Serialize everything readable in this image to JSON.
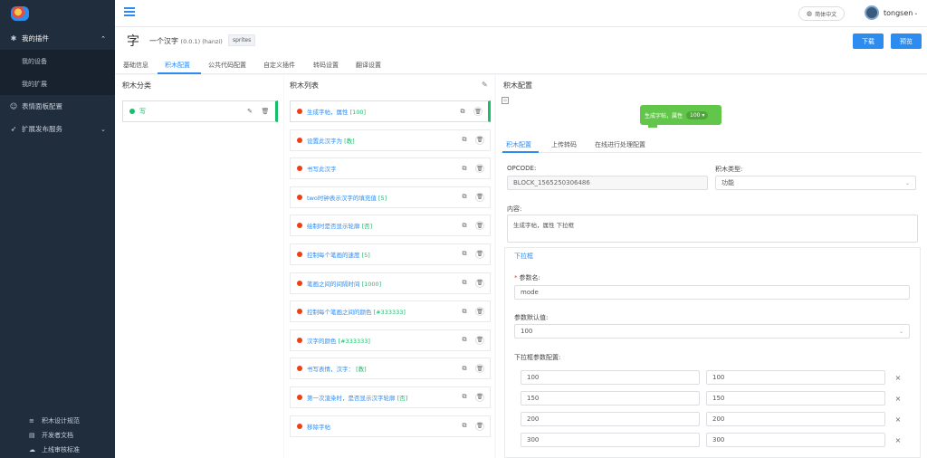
{
  "sidebar": {
    "items": [
      {
        "label": "我的插件",
        "icon": "pin-icon",
        "active": true
      },
      {
        "label": "我的设备",
        "sub": true
      },
      {
        "label": "我的扩展",
        "sub": true
      },
      {
        "label": "表情面板配置",
        "icon": "smile-icon"
      },
      {
        "label": "扩展发布服务",
        "icon": "send-icon"
      }
    ],
    "bottom": [
      {
        "label": "积木设计规范",
        "icon": "layers-icon"
      },
      {
        "label": "开发者文档",
        "icon": "doc-icon"
      },
      {
        "label": "上线审核标准",
        "icon": "cloud-icon"
      }
    ]
  },
  "header": {
    "lang": "简体中文",
    "user": "tongsen"
  },
  "extension": {
    "icon_char": "字",
    "name": "一个汉字",
    "version": "(0.0.1) (hanzi)",
    "tag": "sprites",
    "download": "下载",
    "preview": "预览"
  },
  "tabs": [
    "基础信息",
    "积木配置",
    "公共代码配置",
    "自定义插件",
    "转码设置",
    "翻译设置"
  ],
  "categories_panel": {
    "title": "积木分类",
    "items": [
      {
        "label": "写"
      }
    ]
  },
  "blocks_panel": {
    "title": "积木列表",
    "items": [
      {
        "text": "生成字帖，属性 ",
        "param": "[100]"
      },
      {
        "text": "设置此汉字为 ",
        "param": "[教]"
      },
      {
        "text": "书写此汉字",
        "param": ""
      },
      {
        "text": "two时钟表示汉字的填充值 ",
        "param": "[5]"
      },
      {
        "text": "绘制时是否显示轮廓 ",
        "param": "[否]"
      },
      {
        "text": "控制每个笔画的速度 ",
        "param": "[5]"
      },
      {
        "text": "笔画之间的间隔时间 ",
        "param": "[1000]"
      },
      {
        "text": "控制每个笔画之间的颜色 ",
        "param": "[#333333]"
      },
      {
        "text": "汉字的颜色 ",
        "param": "[#333333]"
      },
      {
        "text": "书写表情，汉字： ",
        "param": "[教]"
      },
      {
        "text": "第一次渲染时，是否显示汉字轮廓 ",
        "param": "[否]"
      },
      {
        "text": "移除字帖",
        "param": ""
      }
    ]
  },
  "config_panel": {
    "title": "积木配置",
    "preview_text": "生成字帖，属性",
    "preview_value": "100 ▾",
    "subtabs": [
      "积木配置",
      "上传转码",
      "在线进行处理配置"
    ],
    "opcode_label": "OPCODE:",
    "opcode_value": "BLOCK_1565250306486",
    "type_label": "积木类型:",
    "type_value": "功能",
    "content_label": "内容:",
    "content_value": "生成字帖，属性 下拉框",
    "dropdown_title": "下拉框",
    "param_name_label": "参数名:",
    "param_name_value": "mode",
    "default_label": "参数默认值:",
    "default_value": "100",
    "options_label": "下拉框参数配置:",
    "options": [
      {
        "key": "100",
        "value": "100"
      },
      {
        "key": "150",
        "value": "150"
      },
      {
        "key": "200",
        "value": "200"
      },
      {
        "key": "300",
        "value": "300"
      }
    ]
  }
}
